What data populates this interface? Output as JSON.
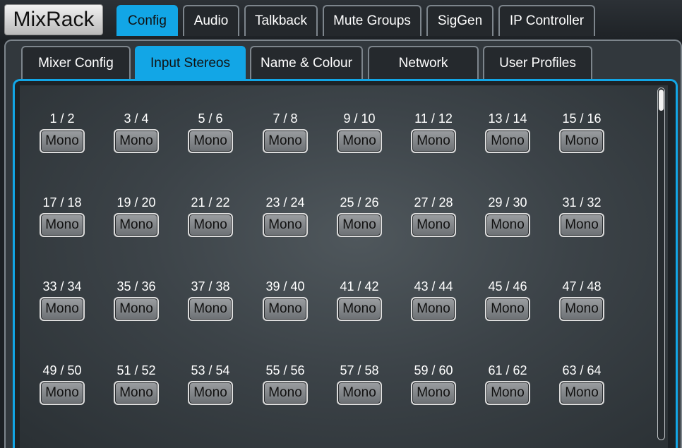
{
  "app": {
    "title": "MixRack"
  },
  "main_tabs": [
    {
      "label": "Config",
      "active": true
    },
    {
      "label": "Audio",
      "active": false
    },
    {
      "label": "Talkback",
      "active": false
    },
    {
      "label": "Mute Groups",
      "active": false
    },
    {
      "label": "SigGen",
      "active": false
    },
    {
      "label": "IP Controller",
      "active": false
    }
  ],
  "sub_tabs": [
    {
      "label": "Mixer Config",
      "active": false
    },
    {
      "label": "Input Stereos",
      "active": true
    },
    {
      "label": "Name & Colour",
      "active": false
    },
    {
      "label": "Network",
      "active": false
    },
    {
      "label": "User Profiles",
      "active": false
    }
  ],
  "pairs": [
    {
      "label": "1 / 2",
      "mode": "Mono"
    },
    {
      "label": "3 / 4",
      "mode": "Mono"
    },
    {
      "label": "5 / 6",
      "mode": "Mono"
    },
    {
      "label": "7 / 8",
      "mode": "Mono"
    },
    {
      "label": "9 / 10",
      "mode": "Mono"
    },
    {
      "label": "11 / 12",
      "mode": "Mono"
    },
    {
      "label": "13 / 14",
      "mode": "Mono"
    },
    {
      "label": "15 / 16",
      "mode": "Mono"
    },
    {
      "label": "17 / 18",
      "mode": "Mono"
    },
    {
      "label": "19 / 20",
      "mode": "Mono"
    },
    {
      "label": "21 / 22",
      "mode": "Mono"
    },
    {
      "label": "23 / 24",
      "mode": "Mono"
    },
    {
      "label": "25 / 26",
      "mode": "Mono"
    },
    {
      "label": "27 / 28",
      "mode": "Mono"
    },
    {
      "label": "29 / 30",
      "mode": "Mono"
    },
    {
      "label": "31 / 32",
      "mode": "Mono"
    },
    {
      "label": "33 / 34",
      "mode": "Mono"
    },
    {
      "label": "35 / 36",
      "mode": "Mono"
    },
    {
      "label": "37 / 38",
      "mode": "Mono"
    },
    {
      "label": "39 / 40",
      "mode": "Mono"
    },
    {
      "label": "41 / 42",
      "mode": "Mono"
    },
    {
      "label": "43 / 44",
      "mode": "Mono"
    },
    {
      "label": "45 / 46",
      "mode": "Mono"
    },
    {
      "label": "47 / 48",
      "mode": "Mono"
    },
    {
      "label": "49 / 50",
      "mode": "Mono"
    },
    {
      "label": "51 / 52",
      "mode": "Mono"
    },
    {
      "label": "53 / 54",
      "mode": "Mono"
    },
    {
      "label": "55 / 56",
      "mode": "Mono"
    },
    {
      "label": "57 / 58",
      "mode": "Mono"
    },
    {
      "label": "59 / 60",
      "mode": "Mono"
    },
    {
      "label": "61 / 62",
      "mode": "Mono"
    },
    {
      "label": "63 / 64",
      "mode": "Mono"
    }
  ],
  "colors": {
    "accent": "#12a6e6",
    "tab_border": "#7d858c",
    "button_face": "#8a8d90"
  }
}
